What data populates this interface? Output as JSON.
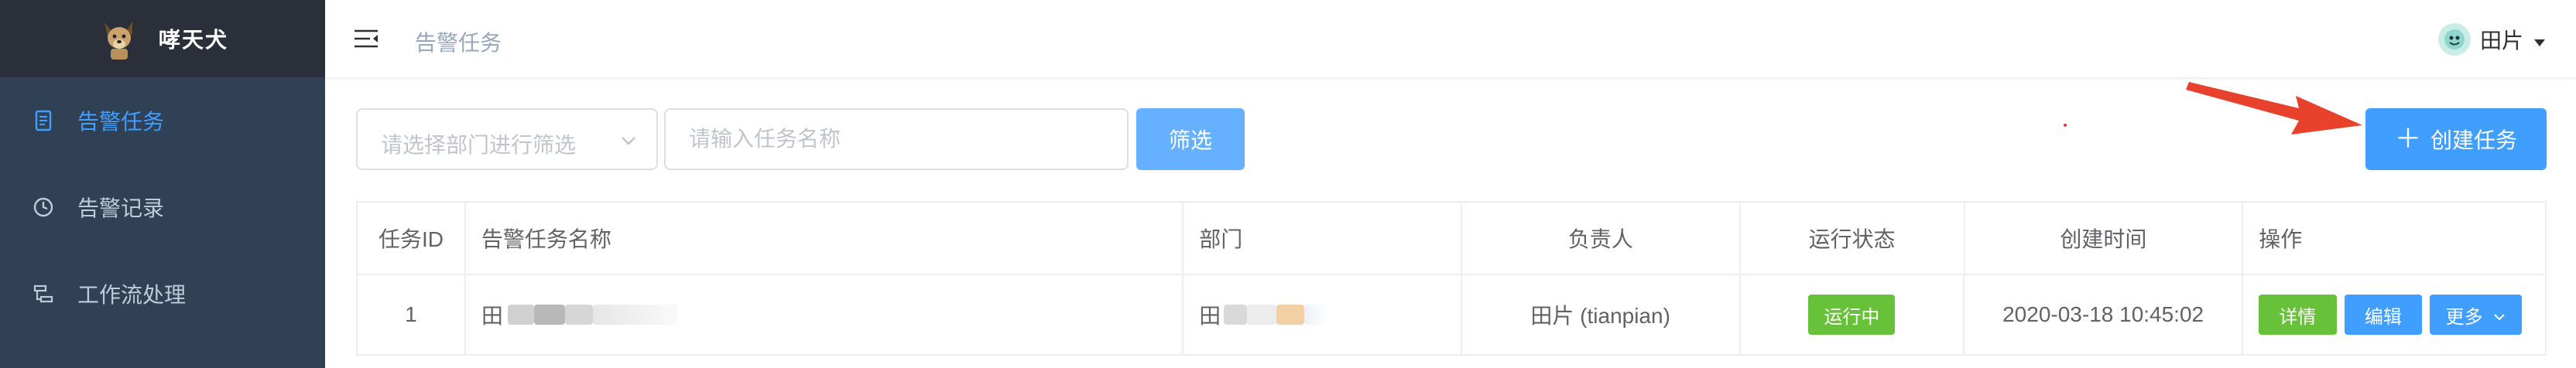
{
  "brand": {
    "name": "哮天犬",
    "logo_icon": "dog-logo-icon"
  },
  "sidebar": {
    "items": [
      {
        "label": "告警任务",
        "icon": "document-icon",
        "active": true
      },
      {
        "label": "告警记录",
        "icon": "clock-icon",
        "active": false
      },
      {
        "label": "工作流处理",
        "icon": "workflow-icon",
        "active": false
      }
    ]
  },
  "header": {
    "breadcrumb": "告警任务",
    "user_name": "田片"
  },
  "toolbar": {
    "department_placeholder": "请选择部门进行筛选",
    "task_name_placeholder": "请输入任务名称",
    "filter_label": "筛选",
    "create_plus": "＋",
    "create_label": "创建任务"
  },
  "table": {
    "headers": [
      "任务ID",
      "告警任务名称",
      "部门",
      "负责人",
      "运行状态",
      "创建时间",
      "操作"
    ],
    "rows": [
      {
        "id": "1",
        "name": "田",
        "department": "田",
        "owner": "田片 (tianpian)",
        "status": "运行中",
        "created_at": "2020-03-18 10:45:02",
        "actions": {
          "detail": "详情",
          "edit": "编辑",
          "more": "更多"
        }
      }
    ]
  },
  "colors": {
    "sidebar_bg": "#304156",
    "brand_bg": "#2b2f3a",
    "accent": "#409eff",
    "success": "#67c23a",
    "annotation_arrow": "#e8412c"
  }
}
